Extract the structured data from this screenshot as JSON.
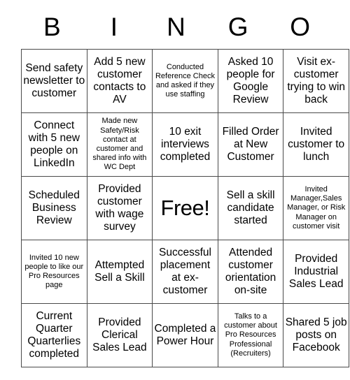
{
  "card": {
    "title": "BINGO",
    "header_letters": [
      "B",
      "I",
      "N",
      "G",
      "O"
    ],
    "free_space_label": "Free!",
    "rows": [
      [
        {
          "text": "Send safety newsletter to customer",
          "size": "normal"
        },
        {
          "text": "Add 5 new customer contacts to AV",
          "size": "normal"
        },
        {
          "text": "Conducted Reference Check and asked if they use staffing",
          "size": "small"
        },
        {
          "text": "Asked 10 people for Google Review",
          "size": "normal"
        },
        {
          "text": "Visit ex-customer trying to win back",
          "size": "normal"
        }
      ],
      [
        {
          "text": "Connect with 5 new people on LinkedIn",
          "size": "normal"
        },
        {
          "text": "Made new Safety/Risk contact at customer and shared info with WC Dept",
          "size": "small"
        },
        {
          "text": "10 exit interviews completed",
          "size": "normal"
        },
        {
          "text": "Filled Order at New Customer",
          "size": "normal"
        },
        {
          "text": "Invited customer to lunch",
          "size": "normal"
        }
      ],
      [
        {
          "text": "Scheduled Business Review",
          "size": "normal"
        },
        {
          "text": "Provided customer with wage survey",
          "size": "normal"
        },
        {
          "text": "Free!",
          "size": "free"
        },
        {
          "text": "Sell a skill candidate started",
          "size": "normal"
        },
        {
          "text": "Invited Manager,Sales Manager, or Risk Manager on customer visit",
          "size": "small"
        }
      ],
      [
        {
          "text": "Invited 10 new people to like our Pro Resources page",
          "size": "small"
        },
        {
          "text": "Attempted Sell a Skill",
          "size": "normal"
        },
        {
          "text": "Successful placement at ex-customer",
          "size": "normal"
        },
        {
          "text": "Attended customer orientation on-site",
          "size": "normal"
        },
        {
          "text": "Provided Industrial Sales Lead",
          "size": "normal"
        }
      ],
      [
        {
          "text": "Current Quarter Quarterlies completed",
          "size": "normal"
        },
        {
          "text": "Provided Clerical Sales Lead",
          "size": "normal"
        },
        {
          "text": "Completed a Power Hour",
          "size": "normal"
        },
        {
          "text": "Talks to a customer about Pro Resources Professional (Recruiters)",
          "size": "small"
        },
        {
          "text": "Shared 5 job posts on Facebook",
          "size": "normal"
        }
      ]
    ]
  }
}
